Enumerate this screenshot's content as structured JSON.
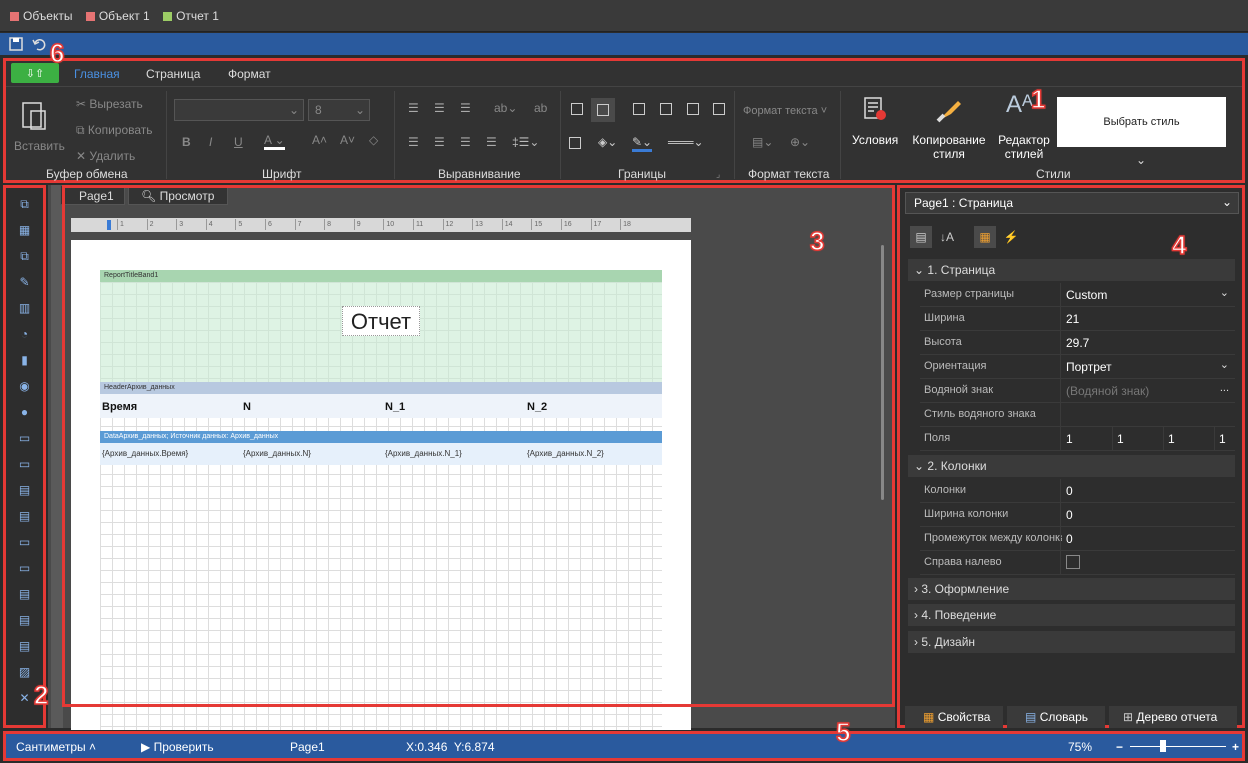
{
  "breadcrumbs": [
    {
      "label": "Объекты",
      "color": "#e57373"
    },
    {
      "label": "Объект 1",
      "color": "#e57373"
    },
    {
      "label": "Отчет 1",
      "color": "#9ccc65"
    }
  ],
  "ribbon": {
    "tabs": [
      "Главная",
      "Страница",
      "Формат"
    ],
    "clipboard": {
      "paste": "Вставить",
      "cut": "Вырезать",
      "copy": "Копировать",
      "delete": "Удалить",
      "label": "Буфер обмена"
    },
    "font": {
      "size": "8",
      "label": "Шрифт"
    },
    "align": {
      "label": "Выравнивание"
    },
    "borders": {
      "label": "Границы"
    },
    "textformat": {
      "btn": "Формат текста",
      "label": "Формат текста"
    },
    "styles": {
      "conditions": "Условия",
      "copy_style_1": "Копирование",
      "copy_style_2": "стиля",
      "editor_1": "Редактор",
      "editor_2": "стилей",
      "choose": "Выбрать стиль",
      "label": "Стили"
    }
  },
  "doc_tabs": [
    "Page1",
    "Просмотр"
  ],
  "ruler": [
    "1",
    "2",
    "3",
    "4",
    "5",
    "6",
    "7",
    "8",
    "9",
    "10",
    "11",
    "12",
    "13",
    "14",
    "15",
    "16",
    "17",
    "18"
  ],
  "report": {
    "title_band": "ReportTitleBand1",
    "title_text": "Отчет",
    "header_band": "HeaderАрхив_данных",
    "headers": [
      "Время",
      "N",
      "N_1",
      "N_2"
    ],
    "data_band": "DataАрхив_данных; Источник данных: Архив_данных",
    "cells": [
      "{Архив_данных.Время}",
      "{Архив_данных.N}",
      "{Архив_данных.N_1}",
      "{Архив_данных.N_2}"
    ]
  },
  "props": {
    "selector": "Page1 : Страница",
    "g1": "1. Страница",
    "rows1": [
      {
        "k": "Размер страницы",
        "v": "Custom"
      },
      {
        "k": "Ширина",
        "v": "21"
      },
      {
        "k": "Высота",
        "v": "29.7"
      },
      {
        "k": "Ориентация",
        "v": "Портрет"
      },
      {
        "k": "Водяной знак",
        "v": "(Водяной знак)"
      },
      {
        "k": "Стиль водяного знака",
        "v": ""
      },
      {
        "k": "Поля",
        "v": ""
      }
    ],
    "margins": [
      "1",
      "1",
      "1",
      "1"
    ],
    "g2": "2. Колонки",
    "rows2": [
      {
        "k": "Колонки",
        "v": "0"
      },
      {
        "k": "Ширина колонки",
        "v": "0"
      },
      {
        "k": "Промежуток между колонками",
        "v": "0"
      },
      {
        "k": "Справа налево",
        "v": ""
      }
    ],
    "g3": "3. Оформление",
    "g4": "4. Поведение",
    "g5": "5. Дизайн",
    "tabs": [
      "Свойства",
      "Словарь",
      "Дерево отчета"
    ]
  },
  "status": {
    "units": "Сантиметры",
    "check": "Проверить",
    "page": "Page1",
    "coords": "X:0.346  Y:6.874",
    "zoom": "75%"
  },
  "markers": [
    "1",
    "2",
    "3",
    "4",
    "5",
    "6"
  ]
}
